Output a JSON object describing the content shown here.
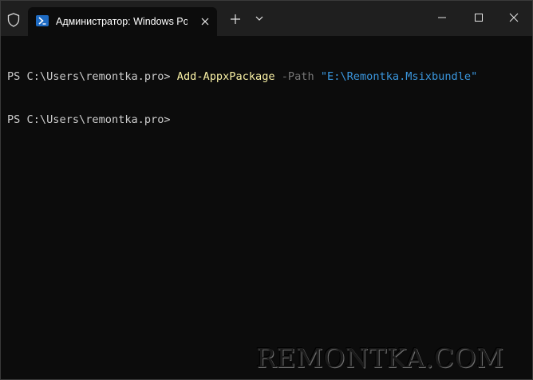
{
  "titlebar": {
    "tab_title": "Администратор: Windows PowerShell",
    "icons": {
      "shield": "shield-icon",
      "powershell": "powershell-icon",
      "close": "close-icon",
      "new_tab": "plus-icon",
      "dropdown": "chevron-down-icon",
      "minimize": "minimize-icon",
      "maximize": "maximize-icon",
      "window_close": "close-icon"
    }
  },
  "terminal": {
    "lines": [
      {
        "prompt": "PS C:\\Users\\remontka.pro> ",
        "command": "Add-AppxPackage",
        "parameter": " -Path ",
        "argument": "\"E:\\Remontka.Msixbundle\""
      },
      {
        "prompt": "PS C:\\Users\\remontka.pro>"
      }
    ]
  },
  "watermark": {
    "text": "REMONTKA.COM"
  },
  "colors": {
    "background": "#0c0c0c",
    "titlebar": "#1f1f1f",
    "command": "#f9f1a5",
    "parameter": "#767676",
    "string": "#3a96dd",
    "text": "#cccccc"
  }
}
